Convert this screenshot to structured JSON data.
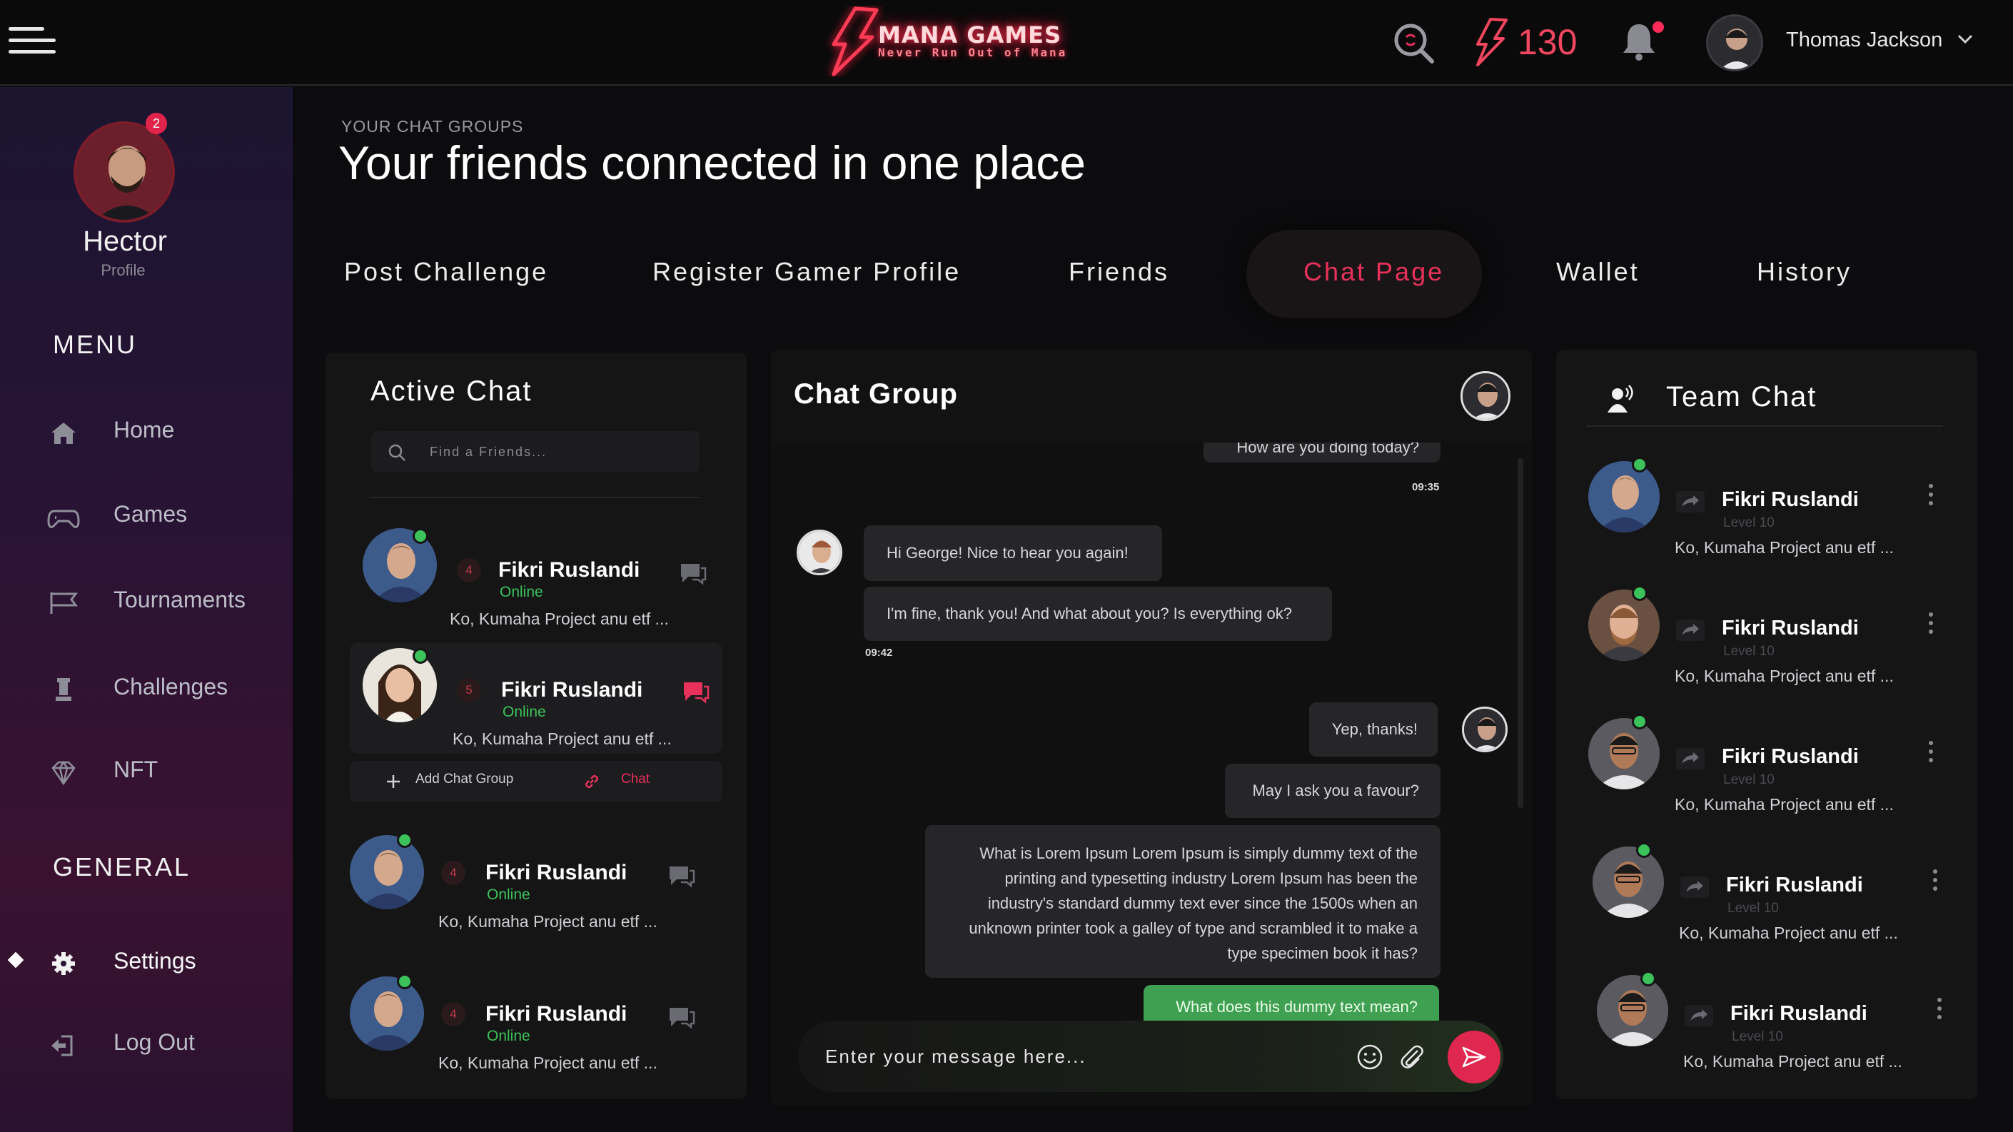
{
  "brand": {
    "name": "MANA GAMES",
    "tagline": "Never Run Out of Mana",
    "accent": "#e8315a"
  },
  "topbar": {
    "mana_count": "130",
    "user_name": "Thomas Jackson",
    "icons": [
      "menu-icon",
      "search-icon",
      "bolt-icon",
      "bell-icon",
      "chevron-down-icon"
    ]
  },
  "sidebar": {
    "profile": {
      "name": "Hector",
      "role": "Profile",
      "badge": "2"
    },
    "menu_heading": "MENU",
    "menu": [
      {
        "label": "Home",
        "icon": "home-icon"
      },
      {
        "label": "Games",
        "icon": "gamepad-icon"
      },
      {
        "label": "Tournaments",
        "icon": "flag-icon"
      },
      {
        "label": "Challenges",
        "icon": "trophy-icon"
      },
      {
        "label": "NFT",
        "icon": "diamond-icon"
      }
    ],
    "general_heading": "GENERAL",
    "general": [
      {
        "label": "Settings",
        "icon": "gear-icon"
      },
      {
        "label": "Log Out",
        "icon": "logout-icon"
      }
    ]
  },
  "header": {
    "eyebrow": "YOUR CHAT GROUPS",
    "title": "Your friends connected in one place"
  },
  "tabs": [
    {
      "label": "Post Challenge"
    },
    {
      "label": "Register Gamer Profile"
    },
    {
      "label": "Friends"
    },
    {
      "label": "Chat Page",
      "active": true
    },
    {
      "label": "Wallet"
    },
    {
      "label": "History"
    }
  ],
  "active_chat": {
    "title": "Active Chat",
    "search_placeholder": "Find a Friends...",
    "friends": [
      {
        "name": "Fikri Ruslandi",
        "status": "Online",
        "count": "4",
        "preview": "Ko, Kumaha Project anu etf ..."
      },
      {
        "name": "Fikri Ruslandi",
        "status": "Online",
        "count": "5",
        "preview": "Ko, Kumaha Project anu etf ..."
      },
      {
        "name": "Fikri Ruslandi",
        "status": "Online",
        "count": "4",
        "preview": "Ko, Kumaha Project anu etf ..."
      },
      {
        "name": "Fikri Ruslandi",
        "status": "Online",
        "count": "4",
        "preview": "Ko, Kumaha Project anu etf ..."
      }
    ],
    "actions": {
      "add_group": "Add Chat Group",
      "chat": "Chat"
    }
  },
  "chat_group": {
    "title": "Chat Group",
    "messages": [
      {
        "text": "How are you doing today?",
        "time": "09:35"
      },
      {
        "text": "Hi George! Nice to hear you again!"
      },
      {
        "text": "I'm fine, thank you! And what about you? Is everything ok?",
        "time": "09:42"
      },
      {
        "text": "Yep, thanks!"
      },
      {
        "text": "May I ask you a favour?"
      },
      {
        "text": "What is Lorem Ipsum Lorem Ipsum is simply dummy text of the printing and typesetting industry Lorem Ipsum has been the industry's standard dummy text ever since the 1500s when an unknown printer took a galley of type and scrambled it to make a type specimen book it has?"
      },
      {
        "text": "What does this dummy text mean?"
      }
    ],
    "input_placeholder": "Enter your message here..."
  },
  "team_chat": {
    "title": "Team Chat",
    "members": [
      {
        "name": "Fikri Ruslandi",
        "level": "Level 10",
        "preview": "Ko, Kumaha Project anu etf ..."
      },
      {
        "name": "Fikri Ruslandi",
        "level": "Level 10",
        "preview": "Ko, Kumaha Project anu etf ..."
      },
      {
        "name": "Fikri Ruslandi",
        "level": "Level 10",
        "preview": "Ko, Kumaha Project anu etf ..."
      },
      {
        "name": "Fikri Ruslandi",
        "level": "Level 10",
        "preview": "Ko, Kumaha Project anu etf ..."
      },
      {
        "name": "Fikri Ruslandi",
        "level": "Level 10",
        "preview": "Ko, Kumaha Project anu etf ..."
      }
    ]
  }
}
